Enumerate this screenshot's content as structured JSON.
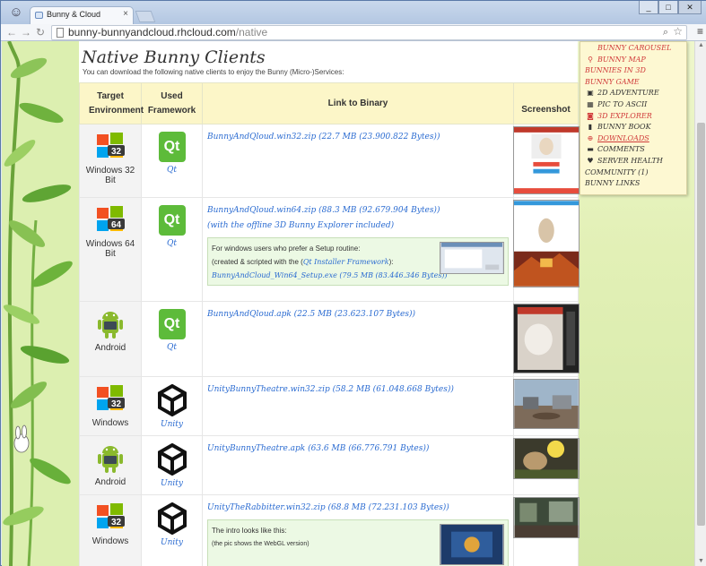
{
  "browser": {
    "tab_title": "Bunny & Cloud",
    "url_host": "bunny-bunnyandcloud.rhcloud.com",
    "url_path": "/native",
    "window_buttons": [
      "_",
      "□",
      "✕"
    ]
  },
  "page": {
    "heading": "Native Bunny Clients",
    "intro": "You can download the following native clients to enjoy the Bunny (Micro-)Services:",
    "columns": [
      "Target Environment",
      "Used Framework",
      "Link to Binary",
      "Screenshot"
    ],
    "rows": [
      {
        "env": "Windows 32 Bit",
        "framework": "Qt",
        "link": "BunnyAndQloud.win32.zip (22.7 MB (23.900.822 Bytes))"
      },
      {
        "env": "Windows 64 Bit",
        "framework": "Qt",
        "link": "BunnyAndQloud.win64.zip (88.3 MB (92.679.904 Bytes))",
        "note": "(with the offline 3D Bunny Explorer included)",
        "box": {
          "line1": "For windows users who prefer a Setup routine:",
          "line2_pre": "(created & scripted with the (",
          "line2_link": "Qt Installer Framework",
          "line2_post": "):",
          "line3": "BunnyAndCloud_Win64_Setup.exe (79.5 MB (83.446.346 Bytes))"
        }
      },
      {
        "env": "Android",
        "framework": "Qt",
        "link": "BunnyAndQloud.apk (22.5 MB (23.623.107 Bytes))"
      },
      {
        "env": "Windows",
        "framework": "Unity",
        "link": "UnityBunnyTheatre.win32.zip (58.2 MB (61.048.668 Bytes))"
      },
      {
        "env": "Android",
        "framework": "Unity",
        "link": "UnityBunnyTheatre.apk (63.6 MB (66.776.791 Bytes))"
      },
      {
        "env": "Windows",
        "framework": "Unity",
        "link": "UnityTheRabbitter.win32.zip (68.8 MB (72.231.103 Bytes))",
        "box": {
          "line1": "The intro looks like this:",
          "line2": "(the pic shows the WebGL version)"
        }
      }
    ]
  },
  "sidebar": {
    "items": [
      {
        "label": "BUNNY CAROUSEL",
        "icon": "",
        "red": true
      },
      {
        "label": "BUNNY MAP",
        "icon": "map-pin-icon",
        "red": true
      },
      {
        "label": "BUNNIES IN 3D",
        "icon": "",
        "red": true
      },
      {
        "label": "BUNNY GAME",
        "icon": "",
        "red": true
      },
      {
        "label": "2D ADVENTURE",
        "icon": "image-icon",
        "red": false
      },
      {
        "label": "PIC TO ASCII",
        "icon": "qr-icon",
        "red": false
      },
      {
        "label": "3D EXPLORER",
        "icon": "camera-icon",
        "red": true
      },
      {
        "label": "BUNNY BOOK",
        "icon": "book-icon",
        "red": false
      },
      {
        "label": "DOWNLOADS",
        "icon": "download-icon",
        "red": true
      },
      {
        "label": "COMMENTS",
        "icon": "comment-icon",
        "red": false
      },
      {
        "label": "SERVER HEALTH",
        "icon": "heart-icon",
        "red": false
      },
      {
        "label": "COMMUNITY (1)",
        "icon": "",
        "red": false
      },
      {
        "label": "BUNNY LINKS",
        "icon": "",
        "red": false
      }
    ]
  },
  "colors": {
    "link": "#2a6bd1",
    "header_bg": "#fcf6c8",
    "sidebar_bg": "#fdf8d2",
    "accent_red": "#d03a3a"
  }
}
